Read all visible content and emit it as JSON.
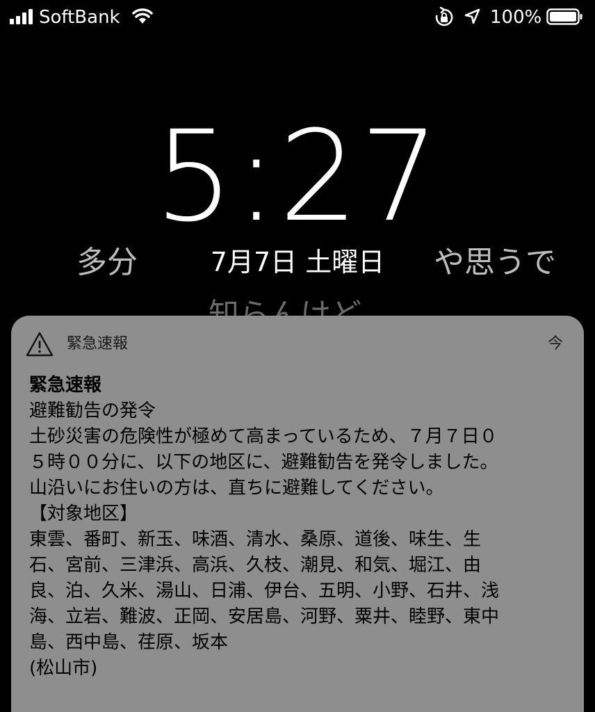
{
  "status_bar": {
    "carrier": "SoftBank",
    "battery_percent": "100%"
  },
  "lock_screen": {
    "time": "5:27",
    "date": "7月7日 土曜日",
    "background_left": "多分",
    "background_right": "や思うで",
    "background_under": "知らんけど"
  },
  "notification": {
    "app_name": "緊急速報",
    "time": "今",
    "title": "緊急速報",
    "lines": [
      "避難勧告の発令",
      "土砂災害の危険性が極めて高まっているため、７月７日０",
      "５時００分に、以下の地区に、避難勧告を発令しました。",
      "山沿いにお住いの方は、直ちに避難してください。",
      "【対象地区】",
      "東雲、番町、新玉、味酒、清水、桑原、道後、味生、生",
      "石、宮前、三津浜、高浜、久枝、潮見、和気、堀江、由",
      "良、泊、久米、湯山、日浦、伊台、五明、小野、石井、浅",
      "海、立岩、難波、正岡、安居島、河野、粟井、睦野、東中",
      "島、西中島、荏原、坂本",
      "(松山市)"
    ]
  }
}
